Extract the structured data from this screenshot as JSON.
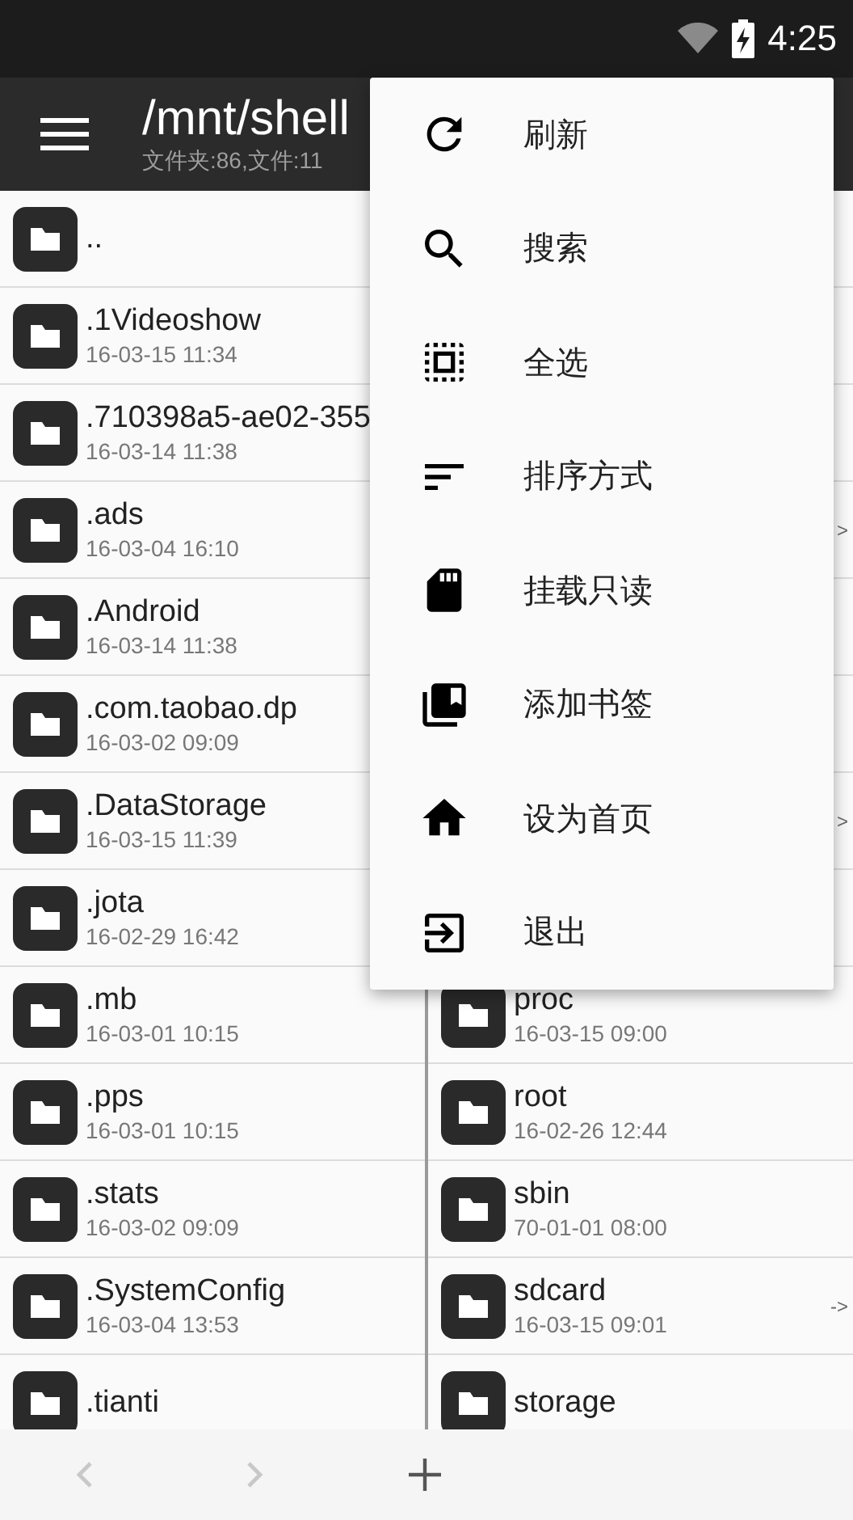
{
  "status_bar": {
    "time": "4:25"
  },
  "app_bar": {
    "title": "/mnt/shell",
    "subtitle": "文件夹:86,文件:11"
  },
  "left_pane": {
    "rows": [
      {
        "name": "..",
        "date": ""
      },
      {
        "name": ".1Videoshow",
        "date": "16-03-15 11:34"
      },
      {
        "name": ".710398a5-ae02-355",
        "date": "16-03-14 11:38"
      },
      {
        "name": ".ads",
        "date": "16-03-04 16:10"
      },
      {
        "name": ".Android",
        "date": "16-03-14 11:38"
      },
      {
        "name": ".com.taobao.dp",
        "date": "16-03-02 09:09"
      },
      {
        "name": ".DataStorage",
        "date": "16-03-15 11:39"
      },
      {
        "name": ".jota",
        "date": "16-02-29 16:42"
      },
      {
        "name": ".mb",
        "date": "16-03-01 10:15"
      },
      {
        "name": ".pps",
        "date": "16-03-01 10:15"
      },
      {
        "name": ".stats",
        "date": "16-03-02 09:09"
      },
      {
        "name": ".SystemConfig",
        "date": "16-03-04 13:53"
      },
      {
        "name": ".tianti"
      }
    ]
  },
  "right_pane": {
    "rows": [
      {},
      {},
      {},
      {
        "link": ">"
      },
      {},
      {},
      {
        "link": ">"
      },
      {},
      {
        "name": "proc",
        "date": "16-03-15 09:00"
      },
      {
        "name": "root",
        "date": "16-02-26 12:44"
      },
      {
        "name": "sbin",
        "date": "70-01-01 08:00"
      },
      {
        "name": "sdcard",
        "date": "16-03-15 09:01",
        "link": "->"
      },
      {
        "name": "storage"
      }
    ]
  },
  "menu": {
    "items": [
      {
        "label": "刷新"
      },
      {
        "label": "搜索"
      },
      {
        "label": "全选"
      },
      {
        "label": "排序方式"
      },
      {
        "label": "挂载只读"
      },
      {
        "label": "添加书签"
      },
      {
        "label": "设为首页"
      },
      {
        "label": "退出"
      }
    ]
  },
  "bottom_bar": {
    "back": {
      "disabled": true
    },
    "forward": {
      "disabled": true
    }
  }
}
